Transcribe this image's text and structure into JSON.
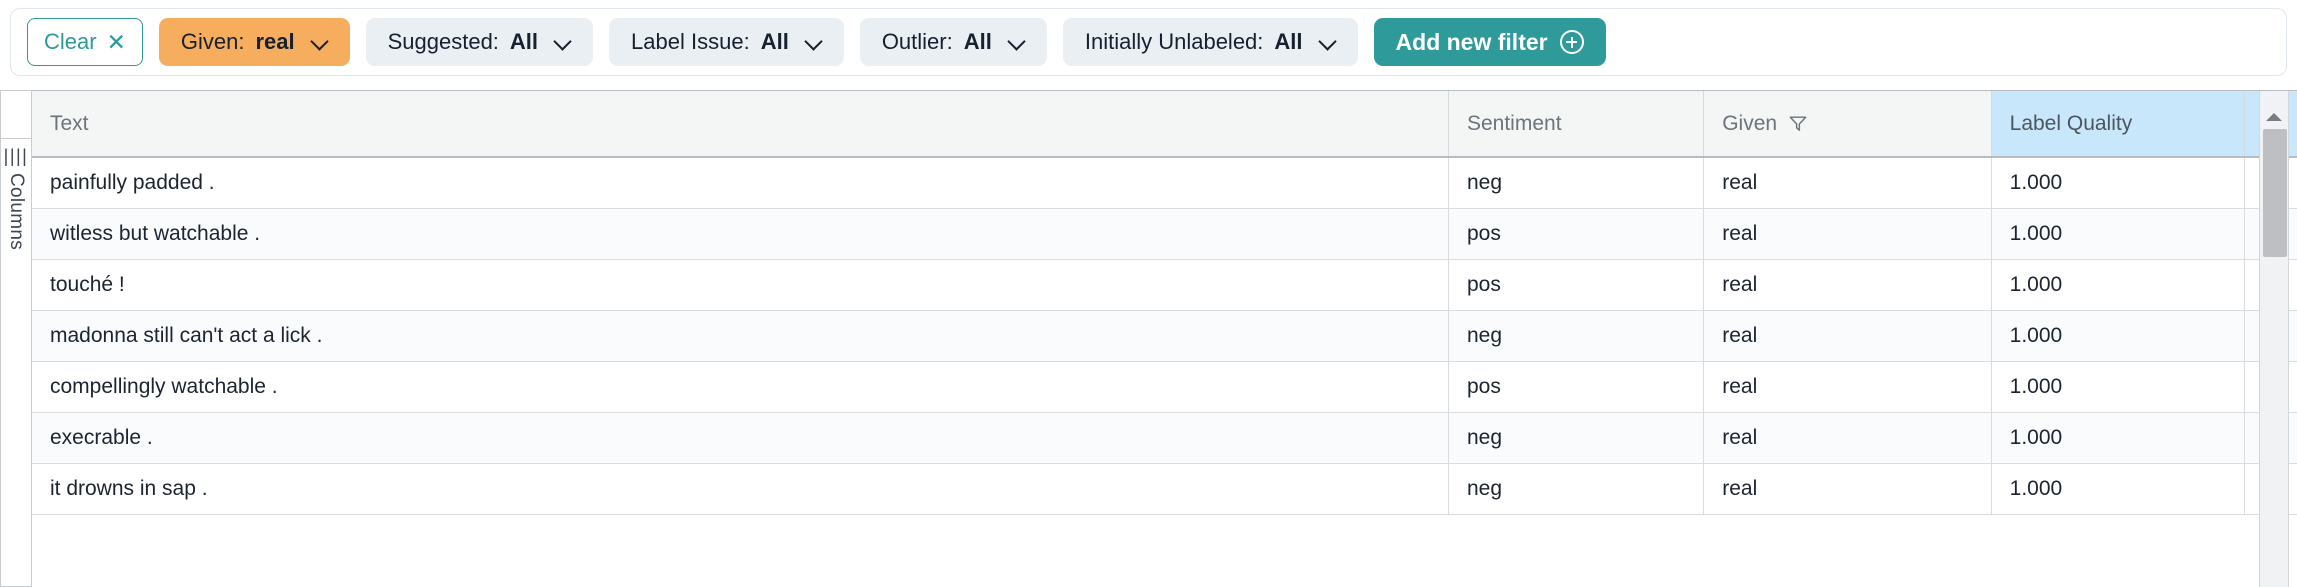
{
  "filter_bar": {
    "clear_button": {
      "label": "Clear",
      "icon": "close-icon",
      "glyph": "✕",
      "border_color": "#2e9a99"
    },
    "chips": [
      {
        "key": "Given:",
        "value": "real",
        "active": true,
        "bg": "#f7ad5e",
        "icon": "chevron-down-icon"
      },
      {
        "key": "Suggested:",
        "value": "All",
        "active": false,
        "bg": "#eaeff4",
        "icon": "chevron-down-icon"
      },
      {
        "key": "Label Issue:",
        "value": "All",
        "active": false,
        "bg": "#eaeff4",
        "icon": "chevron-down-icon"
      },
      {
        "key": "Outlier:",
        "value": "All",
        "active": false,
        "bg": "#eaeff4",
        "icon": "chevron-down-icon"
      },
      {
        "key": "Initially Unlabeled:",
        "value": "All",
        "active": false,
        "bg": "#eaeff4",
        "icon": "chevron-down-icon"
      }
    ],
    "add_filter": {
      "label": "Add new filter",
      "icon": "plus-circle-icon",
      "bg": "#2e9a99"
    }
  },
  "columns_rail": {
    "label": "Columns",
    "icon": "columns-bars-icon",
    "glyph": "||||"
  },
  "table": {
    "columns": [
      {
        "label": "Text",
        "filtered": false,
        "highlighted": false
      },
      {
        "label": "Sentiment",
        "filtered": false,
        "highlighted": false
      },
      {
        "label": "Given",
        "filtered": true,
        "highlighted": false,
        "filter_icon": "funnel-icon"
      },
      {
        "label": "Label Quality",
        "filtered": false,
        "highlighted": true,
        "highlight_color": "#c9e7fb"
      }
    ],
    "rows": [
      {
        "text": "painfully padded .",
        "sentiment": "neg",
        "given": "real",
        "label_quality": "1.000"
      },
      {
        "text": "witless but watchable .",
        "sentiment": "pos",
        "given": "real",
        "label_quality": "1.000"
      },
      {
        "text": "touché !",
        "sentiment": "pos",
        "given": "real",
        "label_quality": "1.000"
      },
      {
        "text": "madonna still can't act a lick .",
        "sentiment": "neg",
        "given": "real",
        "label_quality": "1.000"
      },
      {
        "text": "compellingly watchable .",
        "sentiment": "pos",
        "given": "real",
        "label_quality": "1.000"
      },
      {
        "text": "execrable .",
        "sentiment": "neg",
        "given": "real",
        "label_quality": "1.000"
      },
      {
        "text": "it drowns in sap .",
        "sentiment": "neg",
        "given": "real",
        "label_quality": "1.000"
      }
    ]
  },
  "scrollbar": {
    "orientation": "vertical",
    "up_arrow_icon": "arrow-up-icon"
  }
}
